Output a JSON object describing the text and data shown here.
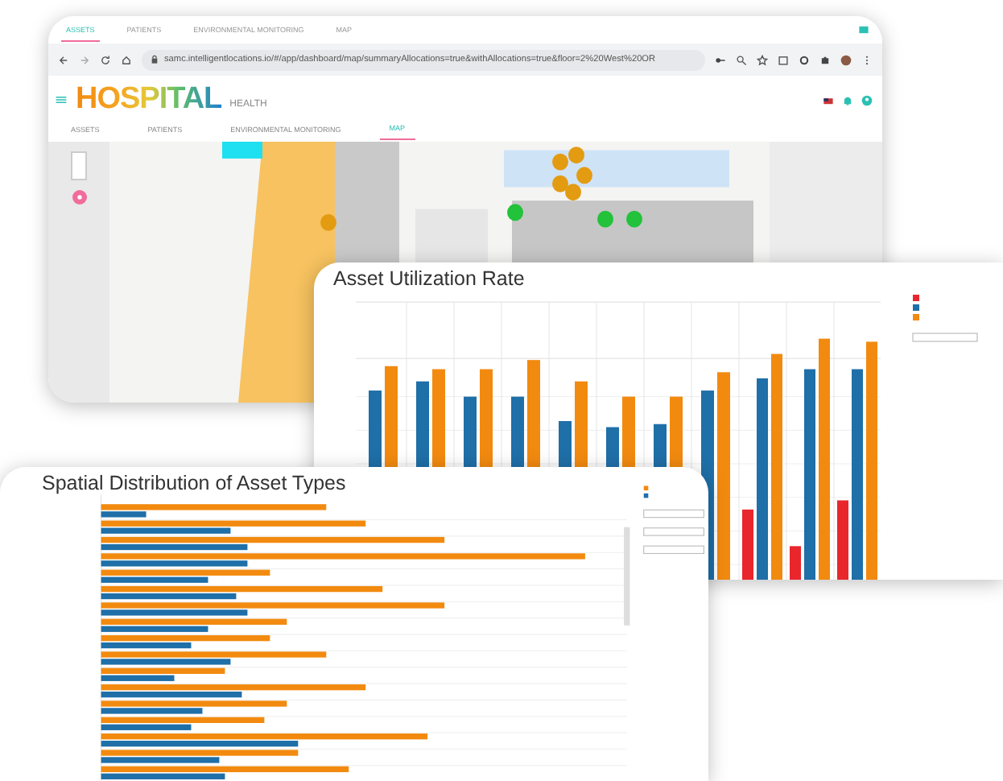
{
  "browser_tabs": [
    {
      "label": "ASSETS",
      "selected": true
    },
    {
      "label": "PATIENTS",
      "selected": false
    },
    {
      "label": "ENVIRONMENTAL MONITORING",
      "selected": false
    },
    {
      "label": "MAP",
      "selected": false
    }
  ],
  "address_bar": {
    "url": "samc.intelligentlocations.io/#/app/dashboard/map/summaryAllocations=true&withAllocations=true&floor=2%20West%20OR"
  },
  "app": {
    "logo": "HOSPITAL",
    "logo_suffix": "HEALTH",
    "nav": [
      {
        "label": "ASSETS",
        "selected": false
      },
      {
        "label": "PATIENTS",
        "selected": false
      },
      {
        "label": "ENVIRONMENTAL MONITORING",
        "selected": false
      },
      {
        "label": "MAP",
        "selected": true
      }
    ]
  },
  "utilization_panel": {
    "title": "Asset Utilization Rate"
  },
  "distribution_panel": {
    "title": "Spatial Distribution of Asset Types"
  }
}
